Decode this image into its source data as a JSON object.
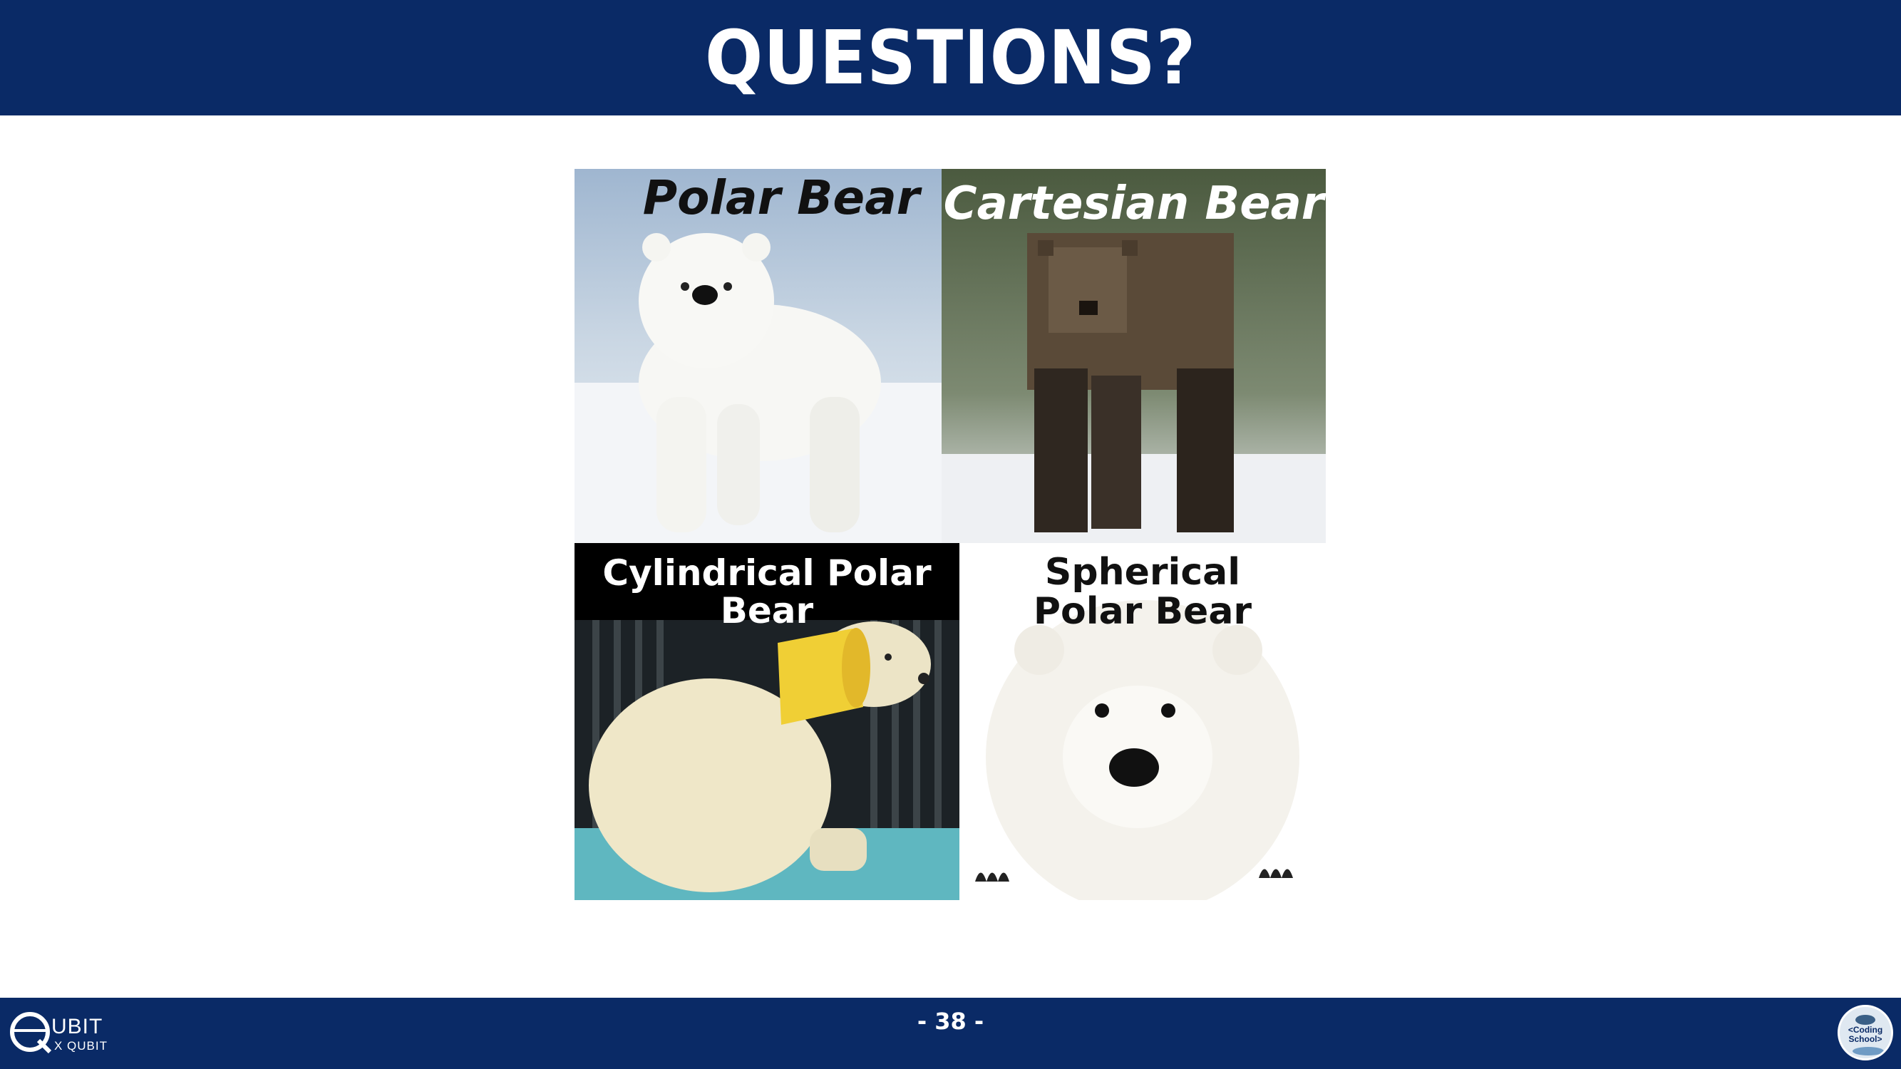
{
  "slide": {
    "title": "QUESTIONS?",
    "page_number": "- 38 -"
  },
  "meme": {
    "panels": [
      {
        "caption": "Polar Bear"
      },
      {
        "caption": "Cartesian Bear"
      },
      {
        "caption": "Cylindrical Polar Bear"
      },
      {
        "caption": "Spherical Polar Bear"
      }
    ]
  },
  "footer": {
    "left_logo": {
      "line1": "UBIT",
      "line2": "X QUBIT"
    },
    "right_logo": {
      "text": "<Coding School>",
      "line1": "<Coding",
      "line2": "School>"
    }
  },
  "colors": {
    "brand": "#0a2a66",
    "background": "#ffffff"
  }
}
